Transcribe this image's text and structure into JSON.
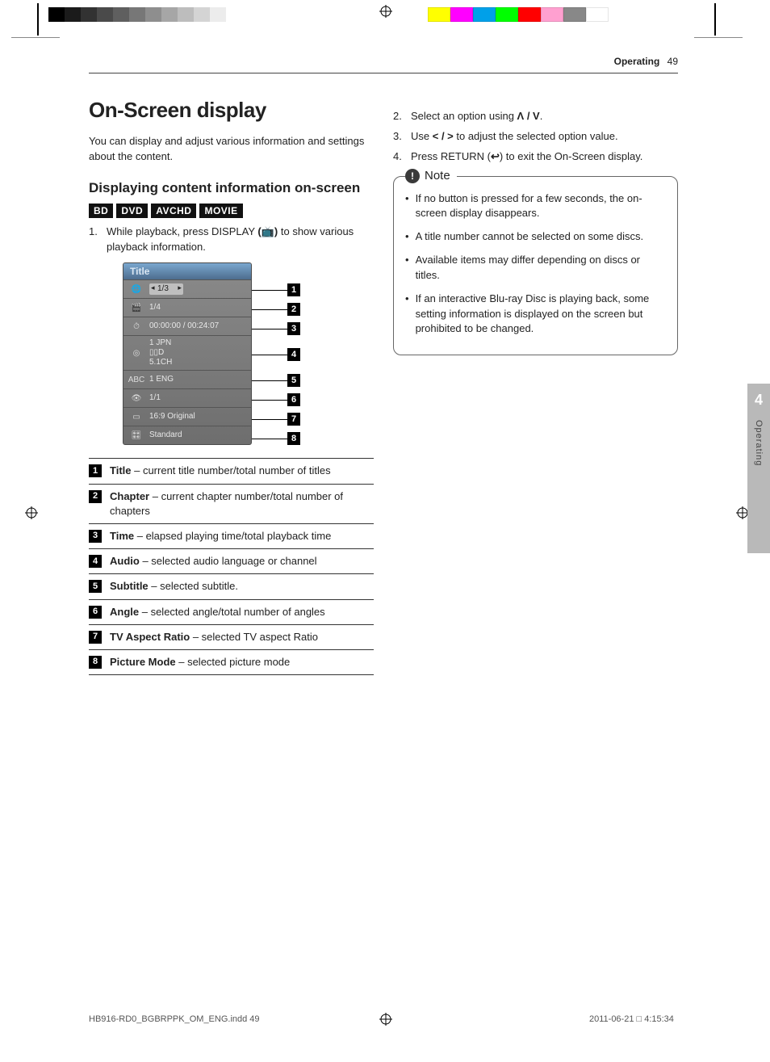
{
  "header": {
    "section": "Operating",
    "page": "49"
  },
  "sideTab": {
    "number": "4",
    "label": "Operating"
  },
  "title": "On-Screen display",
  "intro": "You can display and adjust various information and settings about the content.",
  "subTitle": "Displaying content information on-screen",
  "badges": [
    "BD",
    "DVD",
    "AVCHD",
    "MOVIE"
  ],
  "leftSteps": [
    {
      "n": "1.",
      "pre": "While playback, press DISPLAY ",
      "btn": "(📺)",
      "post": " to show various playback information."
    }
  ],
  "osd": {
    "title": "Title",
    "rows": [
      {
        "val": "1/3",
        "sel": true
      },
      {
        "val": "1/4"
      },
      {
        "val": "00:00:00 / 00:24:07"
      },
      {
        "val": "1 JPN\n▯▯D\n5.1CH",
        "tall": true
      },
      {
        "val": "1 ENG"
      },
      {
        "val": "1/1"
      },
      {
        "val": "16:9 Original"
      },
      {
        "val": "Standard"
      }
    ]
  },
  "legend": [
    {
      "n": "1",
      "term": "Title",
      "desc": " – current title number/total number of titles"
    },
    {
      "n": "2",
      "term": "Chapter",
      "desc": " – current chapter number/total number of chapters"
    },
    {
      "n": "3",
      "term": "Time",
      "desc": " – elapsed playing time/total playback time"
    },
    {
      "n": "4",
      "term": "Audio",
      "desc": " – selected audio language or channel"
    },
    {
      "n": "5",
      "term": "Subtitle",
      "desc": " – selected subtitle."
    },
    {
      "n": "6",
      "term": "Angle",
      "desc": " – selected angle/total number of angles"
    },
    {
      "n": "7",
      "term": "TV Aspect Ratio",
      "desc": " – selected TV aspect Ratio"
    },
    {
      "n": "8",
      "term": "Picture Mode",
      "desc": " – selected picture mode"
    }
  ],
  "rightSteps": [
    {
      "n": "2.",
      "pre": "Select an option using ",
      "glyph": "Λ / V",
      "post": "."
    },
    {
      "n": "3.",
      "pre": "Use ",
      "glyph": "< / >",
      "post": " to adjust the selected option value."
    },
    {
      "n": "4.",
      "pre": "Press RETURN (",
      "glyph": "↩",
      "post": ") to exit the On-Screen display."
    }
  ],
  "noteLabel": "Note",
  "notes": [
    "If no button is pressed for a few seconds, the on-screen display disappears.",
    "A title number cannot be selected on some discs.",
    "Available items may differ depending on discs or titles.",
    "If an interactive Blu-ray Disc is playing back, some setting information is displayed on the screen but prohibited to be changed."
  ],
  "footer": {
    "file": "HB916-RD0_BGBRPPK_OM_ENG.indd   49",
    "stamp": "2011-06-21   □ 4:15:34"
  },
  "colorsLeft": [
    "#000",
    "#1b1b1b",
    "#323232",
    "#4a4a4a",
    "#5f5f5f",
    "#777",
    "#8e8e8e",
    "#a6a6a6",
    "#bdbdbd",
    "#d4d4d4",
    "#ececec",
    "#fff",
    "#fff",
    "#fff",
    "#fff"
  ],
  "colorsRight": [
    "#ffff00",
    "#ff00ff",
    "#00a0e9",
    "#00ff00",
    "#ff0000",
    "#ffa0d0",
    "#888",
    "#fff"
  ]
}
